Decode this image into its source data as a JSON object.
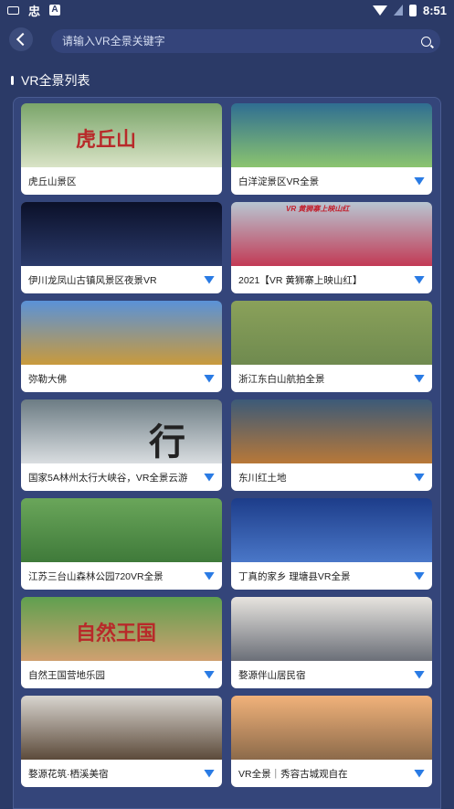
{
  "status": {
    "time": "8:51",
    "icons": [
      "keyboard-icon",
      "app-icon",
      "a-icon",
      "wifi-icon",
      "no-sim-icon",
      "battery-icon"
    ]
  },
  "search": {
    "placeholder": "请输入VR全景关键字"
  },
  "section": {
    "title": "VR全景列表"
  },
  "items": [
    {
      "title": "虎丘山景区",
      "thumb_colors": [
        "#7aa56a",
        "#d9e3c6"
      ],
      "thumb_text": "虎丘山"
    },
    {
      "title": "白洋淀景区VR全景",
      "thumb_colors": [
        "#2f6e92",
        "#8bc46f"
      ]
    },
    {
      "title": "伊川龙凤山古镇风景区夜景VR",
      "thumb_colors": [
        "#0b1029",
        "#2a3a6a"
      ]
    },
    {
      "title": "2021【VR 黄狮寨上映山红】",
      "thumb_colors": [
        "#b8c6d2",
        "#c23a55"
      ],
      "thumb_text": "VR 黄狮寨上映山红"
    },
    {
      "title": "弥勒大佛",
      "thumb_colors": [
        "#5a92d8",
        "#c99a3c"
      ]
    },
    {
      "title": "浙江东白山航拍全景",
      "thumb_colors": [
        "#8aa15a",
        "#6f8a4f"
      ]
    },
    {
      "title": "国家5A林州太行大峡谷，VR全景云游",
      "thumb_colors": [
        "#6c7c84",
        "#d9dde0"
      ],
      "thumb_text": "行"
    },
    {
      "title": "东川红土地",
      "thumb_colors": [
        "#3c5a78",
        "#b87838"
      ]
    },
    {
      "title": "江苏三台山森林公园720VR全景",
      "thumb_colors": [
        "#6aa65a",
        "#3f7a3a"
      ]
    },
    {
      "title": "丁真的家乡 理塘县VR全景",
      "thumb_colors": [
        "#1d3d8a",
        "#4a77c8"
      ]
    },
    {
      "title": "自然王国营地乐园",
      "thumb_colors": [
        "#5fa04f",
        "#d0a070"
      ],
      "thumb_text": "自然王国"
    },
    {
      "title": "婺源伴山居民宿",
      "thumb_colors": [
        "#e7e4df",
        "#6b6f78"
      ]
    },
    {
      "title": "婺源花筑·栖溪美宿",
      "thumb_colors": [
        "#d8d5cf",
        "#5c4a3a"
      ]
    },
    {
      "title": "VR全景｜秀容古城观自在",
      "thumb_colors": [
        "#f1b27a",
        "#8c6a4a"
      ]
    }
  ]
}
